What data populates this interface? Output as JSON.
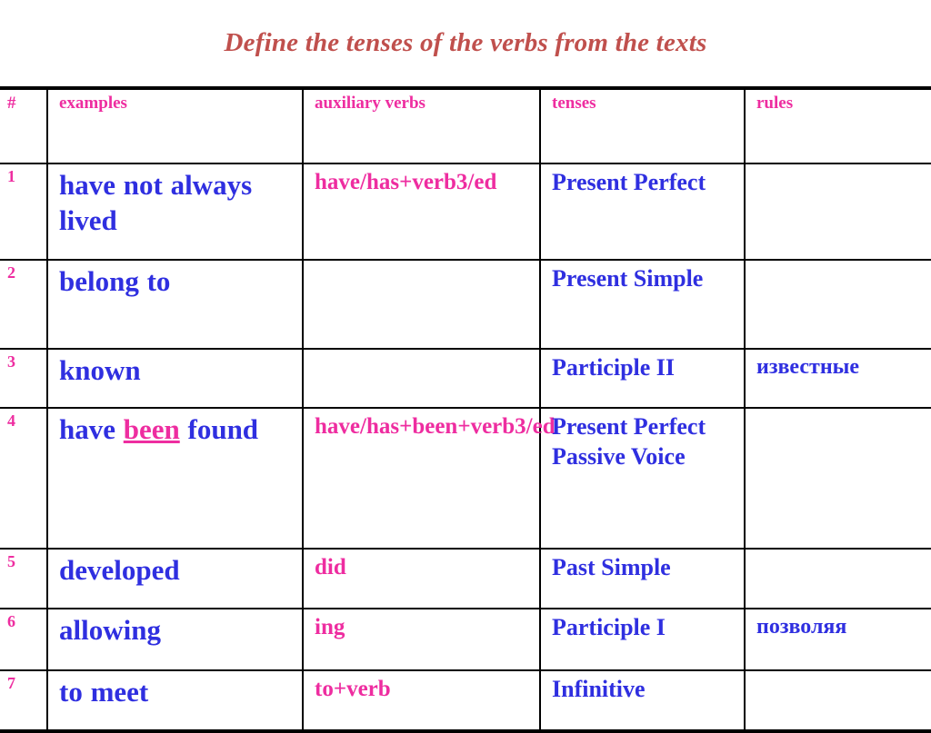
{
  "title": "Define the tenses of the verbs from the texts",
  "table": {
    "headers": {
      "num": "#",
      "examples": "examples",
      "auxiliary": "auxiliary verbs",
      "tenses": "tenses",
      "rules": "rules"
    },
    "rows": [
      {
        "num": "1",
        "example_prefix": "have not always lived",
        "example_highlight": "",
        "example_suffix": "",
        "auxiliary": "have/has+verb3/ed",
        "tense": "Present Perfect",
        "rule": ""
      },
      {
        "num": "2",
        "example_prefix": "belong to",
        "example_highlight": "",
        "example_suffix": "",
        "auxiliary": "",
        "tense": "Present Simple",
        "rule": ""
      },
      {
        "num": "3",
        "example_prefix": "known",
        "example_highlight": "",
        "example_suffix": "",
        "auxiliary": "",
        "tense": "Participle II",
        "rule": "известные"
      },
      {
        "num": "4",
        "example_prefix": "have ",
        "example_highlight": "been",
        "example_suffix": " found",
        "auxiliary": "have/has+been+verb3/ed",
        "tense": "Present Perfect Passive Voice",
        "rule": ""
      },
      {
        "num": "5",
        "example_prefix": "developed",
        "example_highlight": "",
        "example_suffix": "",
        "auxiliary": "did",
        "tense": "Past Simple",
        "rule": ""
      },
      {
        "num": "6",
        "example_prefix": "allowing",
        "example_highlight": "",
        "example_suffix": "",
        "auxiliary": "ing",
        "tense": "Participle I",
        "rule": "позволяя"
      },
      {
        "num": "7",
        "example_prefix": "to meet",
        "example_highlight": "",
        "example_suffix": "",
        "auxiliary": "to+verb",
        "tense": "Infinitive",
        "rule": ""
      }
    ]
  },
  "colors": {
    "title": "#c0504d",
    "magenta": "#ee2da0",
    "blue": "#2f2fe0",
    "border": "#000000",
    "background": "#ffffff"
  }
}
